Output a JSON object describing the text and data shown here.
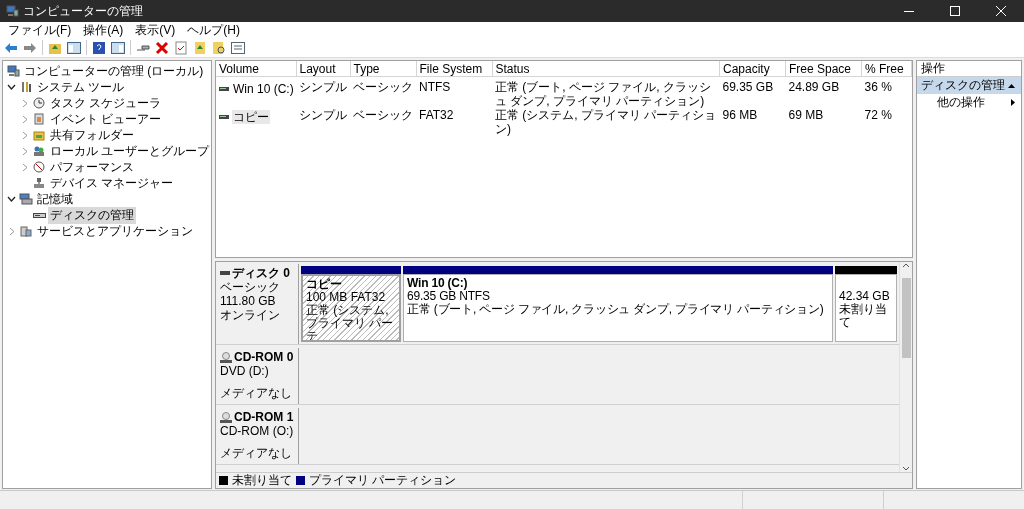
{
  "window": {
    "title": "コンピューターの管理"
  },
  "menu": [
    {
      "label": "ファイル(F)"
    },
    {
      "label": "操作(A)"
    },
    {
      "label": "表示(V)"
    },
    {
      "label": "ヘルプ(H)"
    }
  ],
  "tree": [
    {
      "label": "コンピューターの管理 (ローカル)",
      "kind": "root",
      "selected": false,
      "children": [
        {
          "label": "システム ツール",
          "kind": "branch",
          "expanded": true,
          "selected": false,
          "children": [
            {
              "label": "タスク スケジューラ",
              "kind": "branch",
              "expanded": false,
              "selected": false
            },
            {
              "label": "イベント ビューアー",
              "kind": "branch",
              "expanded": false,
              "selected": false
            },
            {
              "label": "共有フォルダー",
              "kind": "branch",
              "expanded": false,
              "selected": false
            },
            {
              "label": "ローカル ユーザーとグループ",
              "kind": "branch",
              "expanded": false,
              "selected": false
            },
            {
              "label": "パフォーマンス",
              "kind": "branch",
              "expanded": false,
              "selected": false
            },
            {
              "label": "デバイス マネージャー",
              "kind": "leaf",
              "selected": false
            }
          ]
        },
        {
          "label": "記憶域",
          "kind": "branch",
          "expanded": true,
          "selected": false,
          "children": [
            {
              "label": "ディスクの管理",
              "kind": "leaf",
              "selected": true
            }
          ]
        },
        {
          "label": "サービスとアプリケーション",
          "kind": "branch",
          "expanded": false,
          "selected": false
        }
      ]
    }
  ],
  "volumes": {
    "columns": [
      "Volume",
      "Layout",
      "Type",
      "File System",
      "Status",
      "Capacity",
      "Free Space",
      "% Free"
    ],
    "rows": [
      {
        "selected": false,
        "cells": [
          "Win 10 (C:)",
          "シンプル",
          "ベーシック",
          "NTFS",
          "正常 (ブート, ページ ファイル, クラッシュ ダンプ, プライマリ パーティション)",
          "69.35 GB",
          "24.89 GB",
          "36 %"
        ]
      },
      {
        "selected": true,
        "cells": [
          "コピー",
          "シンプル",
          "ベーシック",
          "FAT32",
          "正常 (システム, プライマリ パーティション)",
          "96 MB",
          "69 MB",
          "72 %"
        ]
      }
    ]
  },
  "disks": [
    {
      "kind": "disk",
      "name": "ディスク 0",
      "type": "ベーシック",
      "size": "111.80 GB",
      "state": "オンライン",
      "partitions": [
        {
          "kind": "primary",
          "selected": true,
          "name": "コピー",
          "size": "100 MB FAT32",
          "status": "正常 (システム, プライマリ パーテ"
        },
        {
          "kind": "primary",
          "selected": false,
          "name": "Win 10  (C:)",
          "size": "69.35 GB NTFS",
          "status": "正常 (ブート, ページ ファイル, クラッシュ ダンプ, プライマリ パーティション)"
        },
        {
          "kind": "unallocated",
          "selected": false,
          "size": "42.34 GB",
          "status": "未割り当て"
        }
      ]
    },
    {
      "kind": "cdrom",
      "name": "CD-ROM 0",
      "type": "DVD (D:)",
      "state": "メディアなし"
    },
    {
      "kind": "cdrom",
      "name": "CD-ROM 1",
      "type": "CD-ROM (O:)",
      "state": "メディアなし"
    }
  ],
  "legend": [
    {
      "label": "未割り当て",
      "color": "#000000"
    },
    {
      "label": "プライマリ パーティション",
      "color": "#000080"
    }
  ],
  "actions": {
    "title": "操作",
    "sections": [
      {
        "label": "ディスクの管理",
        "expanded": true,
        "items": [
          {
            "label": "他の操作"
          }
        ]
      }
    ]
  }
}
